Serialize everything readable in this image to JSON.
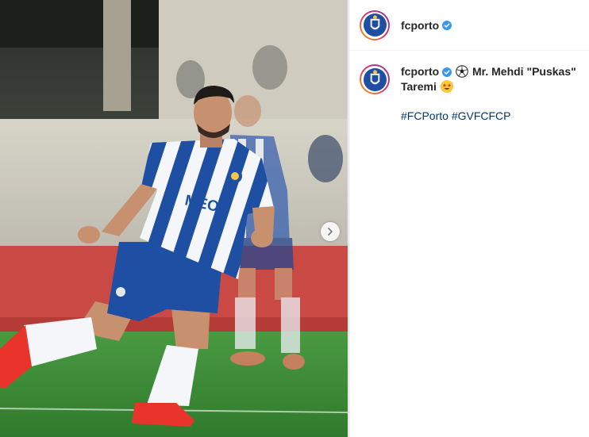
{
  "post": {
    "username": "fcporto",
    "verified": true,
    "caption_text_1": "Mr. Mehdi \"Puskas\"",
    "caption_text_2": "Taremi",
    "caption_emoji_1": "soccer-ball",
    "caption_emoji_2": "star-struck-face",
    "hashtags": [
      "#FCPorto",
      "#GVFCFCP"
    ]
  },
  "media": {
    "description": "football-player-photo",
    "kit_colors": {
      "blue": "#1e4fa3",
      "white": "#f4f6fa",
      "boot_red": "#e8342a",
      "pitch_green": "#3f8a3a"
    },
    "has_next": true
  },
  "colors": {
    "link": "#00376b",
    "verified": "#3897f0",
    "text": "#262626",
    "border": "#dbdbdb"
  }
}
